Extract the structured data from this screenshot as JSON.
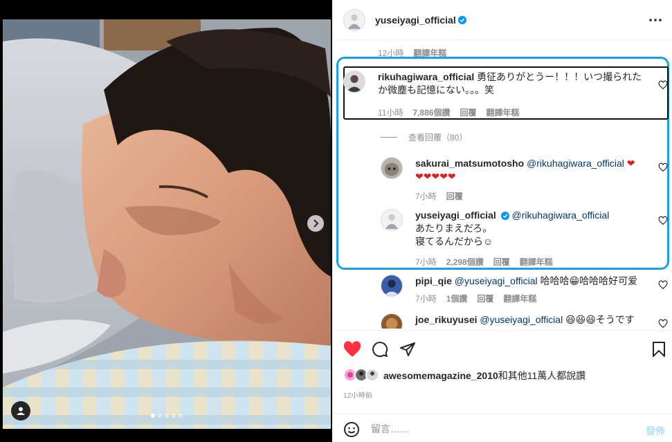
{
  "post": {
    "author": "yuseiyagi_official"
  },
  "caption_meta": {
    "time": "12小時",
    "translate": "翻譯年糕"
  },
  "comments": [
    {
      "user": "rikuhagiwara_official",
      "line1": "勇征ありがとうー！！！いつ撮られた",
      "line2": "か微塵も記憶にない。。。笑",
      "time": "11小時",
      "likes": "7,886個讚",
      "reply": "回覆",
      "translate": "翻譯年糕"
    }
  ],
  "view_replies": "查看回覆（80）",
  "replies": [
    {
      "user": "sakurai_matsumotosho",
      "mention": "@rikuhagiwara_official",
      "text_line1": "❤",
      "text_line2": "❤❤❤❤❤",
      "time": "7小時",
      "reply": "回覆"
    },
    {
      "user": "yuseiyagi_official",
      "mention": "@rikuhagiwara_official",
      "line1": "あたりまえだろ。",
      "line2": "寝てるんだから☺",
      "time": "7小時",
      "likes": "2,298個讚",
      "reply": "回覆",
      "translate": "翻譯年糕"
    }
  ],
  "more_comments": [
    {
      "user": "pipi_qie",
      "mention": "@yuseiyagi_official",
      "text": "哈哈哈😁哈哈哈好可爱",
      "time": "7小時",
      "likes": "1個讚",
      "reply": "回覆",
      "translate": "翻譯年糕"
    },
    {
      "user": "joe_rikuyusei",
      "mention": "@yuseiyagi_official",
      "text": "😆😆😆そうです"
    }
  ],
  "likes": {
    "user": "awesomemagazine_2010",
    "rest": "和其他11萬人都說讚"
  },
  "time_ago": "12小時前",
  "add_comment": {
    "placeholder": "留言……",
    "post_label": "發佈"
  },
  "colors": {
    "accent_blue": "#0095f6",
    "highlight": "#17a2e6",
    "like_red": "#ff3040"
  }
}
